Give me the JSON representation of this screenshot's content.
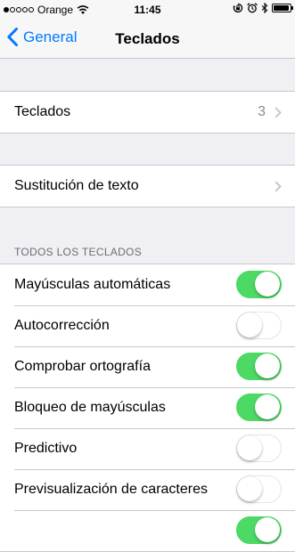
{
  "status_bar": {
    "carrier": "Orange",
    "time": "11:45",
    "signal_dots_filled": 1,
    "signal_dots_total": 5,
    "battery_level": 0.95
  },
  "nav": {
    "back_label": "General",
    "title": "Teclados"
  },
  "keyboards_row": {
    "label": "Teclados",
    "detail": "3"
  },
  "text_replacement_row": {
    "label": "Sustitución de texto"
  },
  "all_keyboards": {
    "header": "TODOS LOS TECLADOS",
    "items": [
      {
        "label": "Mayúsculas automáticas",
        "on": true
      },
      {
        "label": "Autocorrección",
        "on": false
      },
      {
        "label": "Comprobar ortografía",
        "on": true
      },
      {
        "label": "Bloqueo de mayúsculas",
        "on": true
      },
      {
        "label": "Predictivo",
        "on": false
      },
      {
        "label": "Previsualización de caracteres",
        "on": false
      },
      {
        "label": "",
        "on": true
      }
    ]
  },
  "colors": {
    "accent": "#007aff",
    "switch_on": "#4cd964",
    "background": "#efeff4"
  }
}
